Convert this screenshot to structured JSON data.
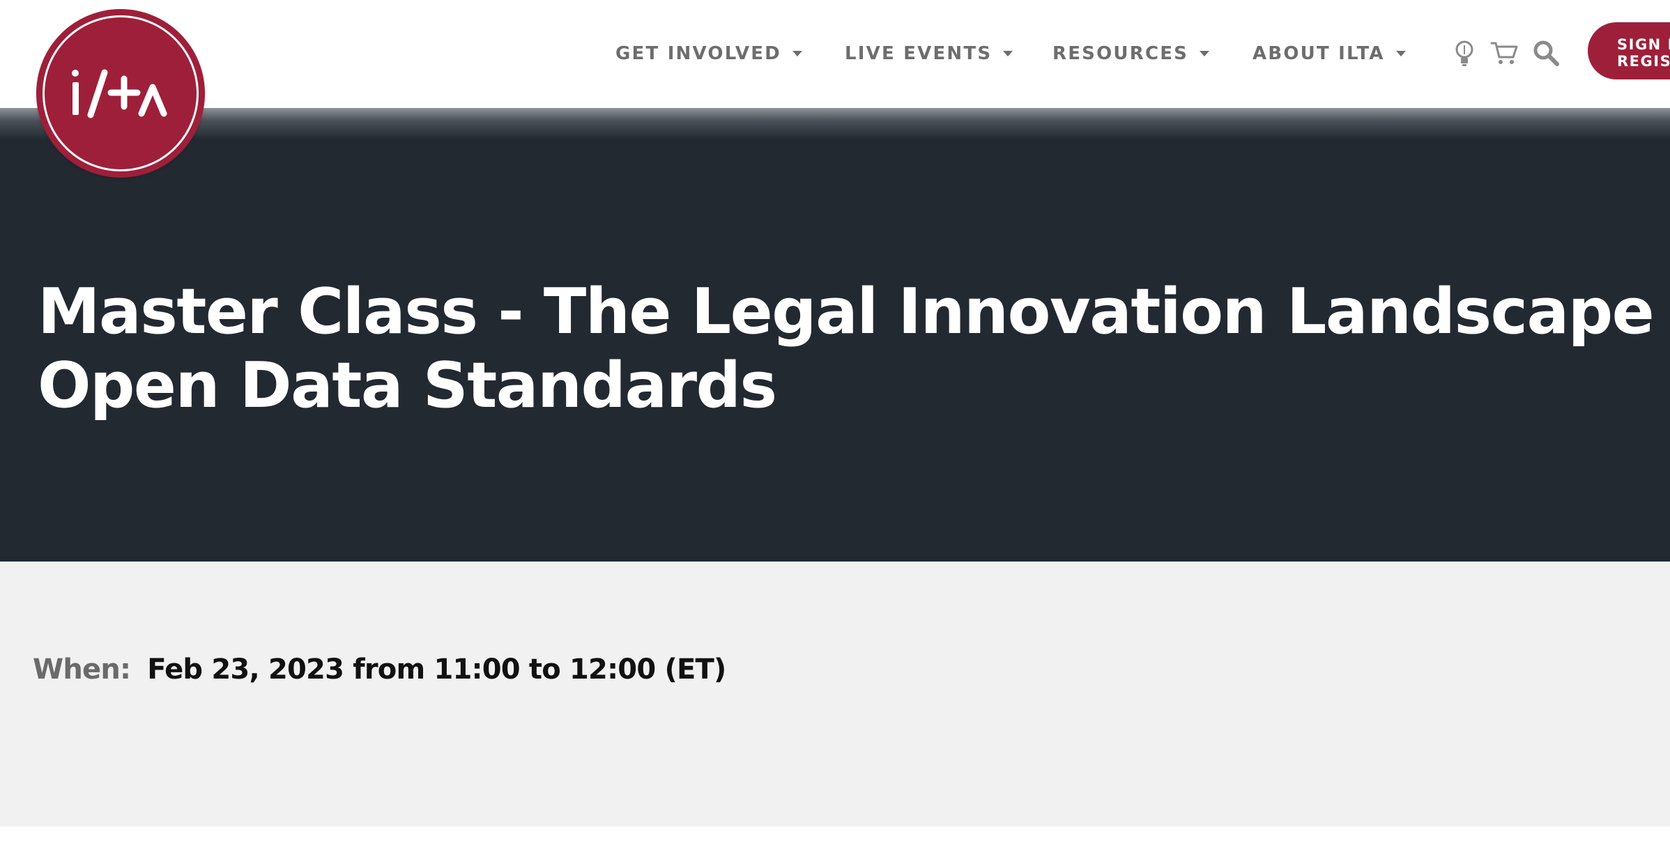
{
  "brand": {
    "logo_icon": "ilta-logo-icon",
    "color": "#9e1f3a"
  },
  "nav": {
    "items": [
      {
        "label": "GET INVOLVED",
        "icon": "caret-down-icon"
      },
      {
        "label": "LIVE EVENTS",
        "icon": "caret-down-icon"
      },
      {
        "label": "RESOURCES",
        "icon": "caret-down-icon"
      },
      {
        "label": "ABOUT ILTA",
        "icon": "caret-down-icon"
      }
    ],
    "icons": [
      "lightbulb-icon",
      "cart-icon",
      "search-icon"
    ],
    "signin_line1": "SIGN IN",
    "signin_line2": "REGISTER"
  },
  "hero": {
    "title_line1": "Master Class - The Legal Innovation Landscape –",
    "title_line2": "Open Data Standards",
    "background": "#232931"
  },
  "event": {
    "when_label": "When:",
    "when_value": "Feb 23, 2023 from 11:00 to 12:00 (ET)"
  }
}
